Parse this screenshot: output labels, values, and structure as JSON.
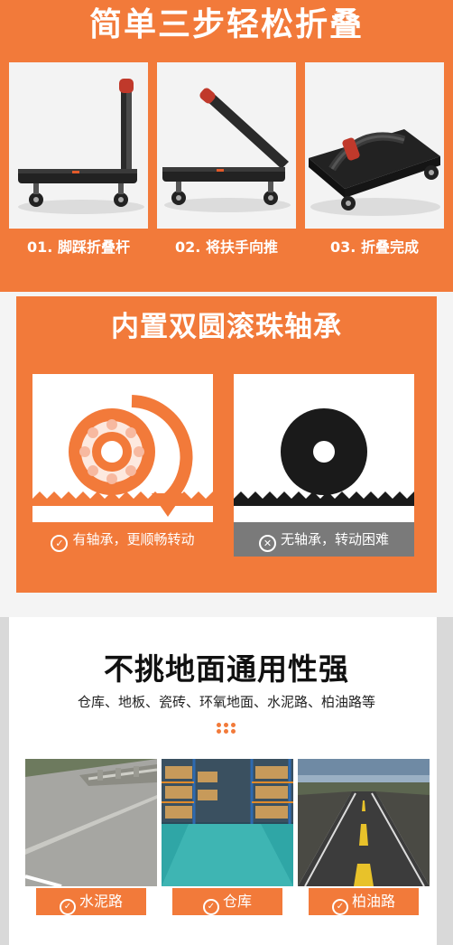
{
  "section1": {
    "title": "简单三步轻松折叠",
    "steps": [
      {
        "label": "01. 脚踩折叠杆"
      },
      {
        "label": "02. 将扶手向推"
      },
      {
        "label": "03. 折叠完成"
      }
    ]
  },
  "section2": {
    "title": "内置双圆滚珠轴承",
    "cards": [
      {
        "label": "有轴承，更顺畅转动",
        "icon": "check-circle-icon"
      },
      {
        "label": "无轴承，转动困难",
        "icon": "x-circle-icon"
      }
    ]
  },
  "section3": {
    "title": "不挑地面通用性强",
    "subtitle": "仓库、地板、瓷砖、环氧地面、水泥路、柏油路等",
    "grounds": [
      {
        "label": "水泥路",
        "icon": "check-circle-icon"
      },
      {
        "label": "仓库",
        "icon": "check-circle-icon"
      },
      {
        "label": "柏油路",
        "icon": "check-circle-icon"
      }
    ]
  },
  "colors": {
    "accent": "#f27a3a",
    "dark": "#1a1a1a",
    "grey_label": "#7a7a7a"
  }
}
